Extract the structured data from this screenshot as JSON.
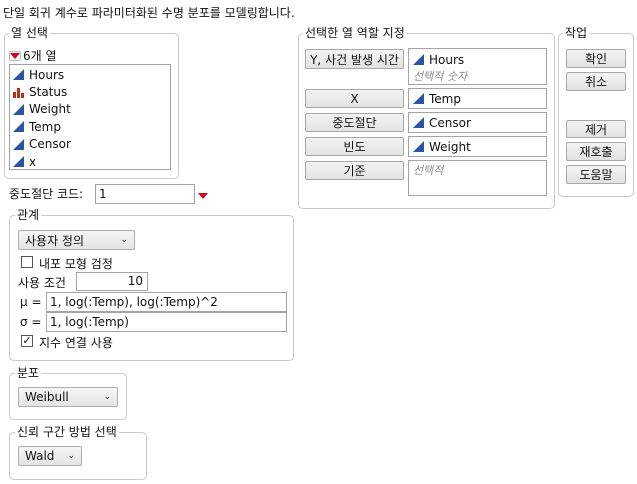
{
  "description": "단일 회귀 계수로 파라미터화된 수명 분포를 모델링합니다.",
  "column_select": {
    "title": "열 선택",
    "count_label": "6개 열",
    "columns": [
      {
        "name": "Hours",
        "icon": "continuous-icon"
      },
      {
        "name": "Status",
        "icon": "nominal-bar-icon"
      },
      {
        "name": "Weight",
        "icon": "continuous-icon"
      },
      {
        "name": "Temp",
        "icon": "continuous-icon"
      },
      {
        "name": "Censor",
        "icon": "continuous-icon"
      },
      {
        "name": "x",
        "icon": "continuous-icon"
      }
    ]
  },
  "censor_code": {
    "label": "중도절단 코드:",
    "value": "1"
  },
  "roles": {
    "title": "선택한 열 역할 지정",
    "y": {
      "button": "Y, 사건 발생 시간",
      "items": [
        "Hours"
      ],
      "placeholder": "선택적 숫자"
    },
    "x": {
      "button": "X",
      "items": [
        "Temp"
      ]
    },
    "censor": {
      "button": "중도절단",
      "items": [
        "Censor"
      ]
    },
    "freq": {
      "button": "빈도",
      "items": [
        "Weight"
      ]
    },
    "by": {
      "button": "기준",
      "placeholder": "선택적"
    }
  },
  "actions": {
    "title": "작업",
    "ok": "확인",
    "cancel": "취소",
    "remove": "제거",
    "recall": "재호출",
    "help": "도움말"
  },
  "relationship": {
    "title": "관계",
    "type_value": "사용자 정의",
    "nested_test_label": "내포 모형 검정",
    "nested_test_checked": false,
    "usage_label": "사용 조건",
    "usage_value": "10",
    "mu_label": "μ =",
    "mu_value": "1, log(:Temp), log(:Temp)^2",
    "sigma_label": "σ =",
    "sigma_value": "1, log(:Temp)",
    "exp_link_label": "지수 연결 사용",
    "exp_link_checked": true
  },
  "distribution": {
    "title": "분포",
    "value": "Weibull"
  },
  "ci_method": {
    "title": "신뢰 구간 방법 선택",
    "value": "Wald"
  },
  "colors": {
    "accent_blue": "#2a55a5",
    "red_indicator": "#d0021b",
    "nominal_red": "#b5311e"
  }
}
